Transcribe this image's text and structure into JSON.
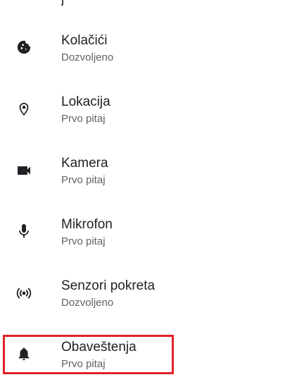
{
  "cutoff_text": "...j",
  "items": [
    {
      "title": "Kolačići",
      "subtitle": "Dozvoljeno",
      "icon": "cookie-icon"
    },
    {
      "title": "Lokacija",
      "subtitle": "Prvo pitaj",
      "icon": "location-pin-icon"
    },
    {
      "title": "Kamera",
      "subtitle": "Prvo pitaj",
      "icon": "camera-icon"
    },
    {
      "title": "Mikrofon",
      "subtitle": "Prvo pitaj",
      "icon": "microphone-icon"
    },
    {
      "title": "Senzori pokreta",
      "subtitle": "Dozvoljeno",
      "icon": "motion-sensors-icon"
    },
    {
      "title": "Obaveštenja",
      "subtitle": "Prvo pitaj",
      "icon": "bell-icon"
    }
  ],
  "highlight_color": "#e0202a"
}
